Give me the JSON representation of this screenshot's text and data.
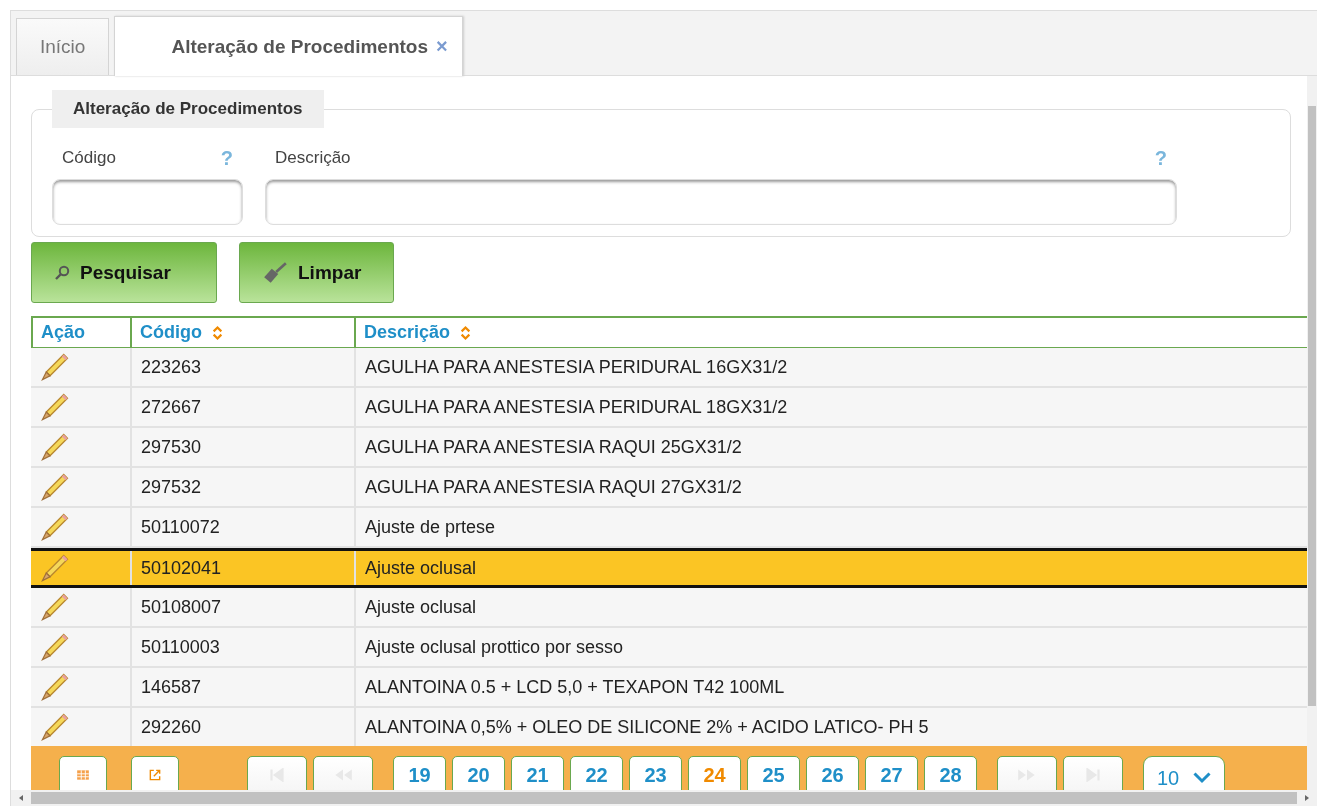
{
  "tabs": [
    {
      "label": "Início",
      "selected": false
    },
    {
      "label": "Alteração de Procedimentos",
      "selected": true,
      "close": "×"
    }
  ],
  "form": {
    "legend": "Alteração de Procedimentos",
    "fields": [
      {
        "label": "Código",
        "help": "?"
      },
      {
        "label": "Descrição",
        "help": "?"
      }
    ]
  },
  "buttons": [
    {
      "label": "Pesquisar",
      "kind": "search"
    },
    {
      "label": "Limpar",
      "kind": "clear"
    }
  ],
  "table": {
    "columns": [
      {
        "label": "Ação",
        "sortable": false
      },
      {
        "label": "Código",
        "sortable": true
      },
      {
        "label": "Descrição",
        "sortable": true
      }
    ],
    "rows": [
      {
        "code": "223263",
        "description": "AGULHA PARA ANESTESIA PERIDURAL 16GX31/2",
        "selected": false
      },
      {
        "code": "272667",
        "description": "AGULHA PARA ANESTESIA PERIDURAL 18GX31/2",
        "selected": false
      },
      {
        "code": "297530",
        "description": "AGULHA PARA ANESTESIA RAQUI 25GX31/2",
        "selected": false
      },
      {
        "code": "297532",
        "description": "AGULHA PARA ANESTESIA RAQUI 27GX31/2",
        "selected": false
      },
      {
        "code": "50110072",
        "description": "Ajuste de prtese",
        "selected": false
      },
      {
        "code": "50102041",
        "description": "Ajuste oclusal",
        "selected": true
      },
      {
        "code": "50108007",
        "description": "Ajuste oclusal",
        "selected": false
      },
      {
        "code": "50110003",
        "description": "Ajuste oclusal prottico por sesso",
        "selected": false
      },
      {
        "code": "146587",
        "description": "ALANTOINA 0.5 + LCD 5,0 + TEXAPON T42 100ML",
        "selected": false
      },
      {
        "code": "292260",
        "description": "ALANTOINA 0,5% + OLEO DE SILICONE 2% + ACIDO LATICO- PH 5",
        "selected": false
      }
    ]
  },
  "pager": {
    "pages": [
      {
        "label": "19",
        "selected": false
      },
      {
        "label": "20",
        "selected": false
      },
      {
        "label": "21",
        "selected": false
      },
      {
        "label": "22",
        "selected": false
      },
      {
        "label": "23",
        "selected": false
      },
      {
        "label": "24",
        "selected": true
      },
      {
        "label": "25",
        "selected": false
      },
      {
        "label": "26",
        "selected": false
      },
      {
        "label": "27",
        "selected": false
      },
      {
        "label": "28",
        "selected": false
      }
    ],
    "page_size": "10"
  }
}
